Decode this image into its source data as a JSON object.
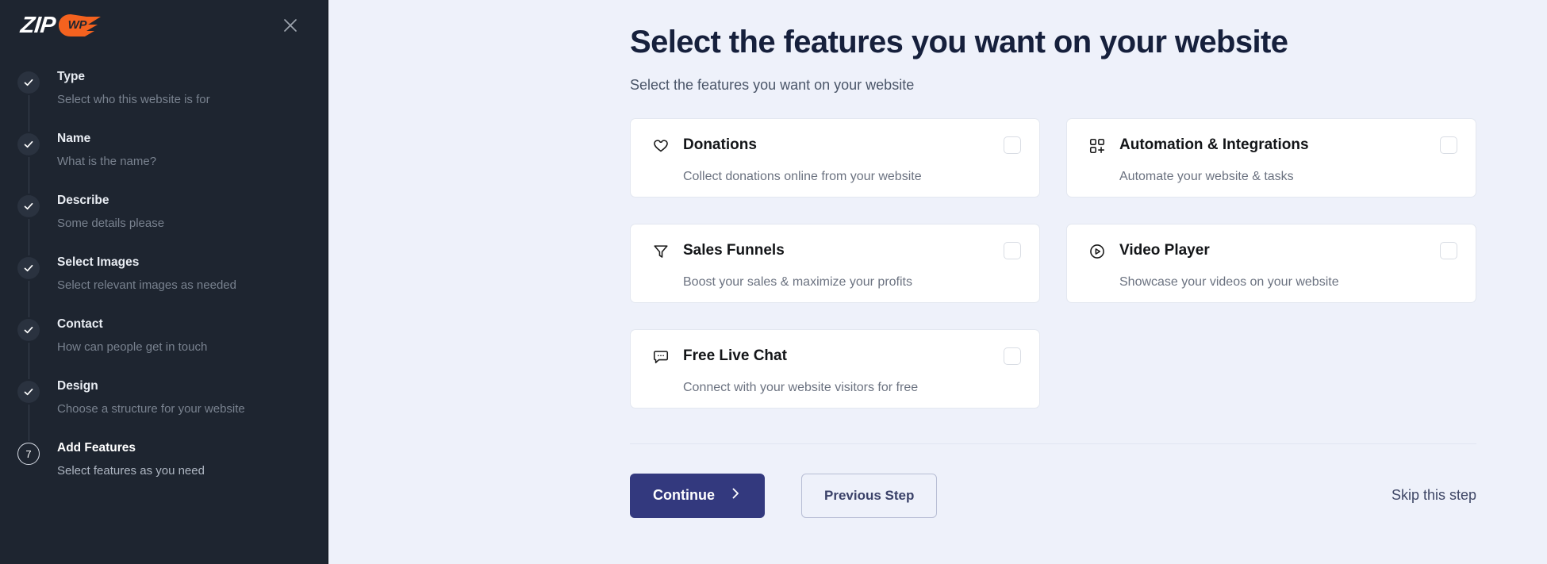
{
  "sidebar": {
    "logo": {
      "zip_text": "ZIP",
      "wp_text": "WP",
      "badge_color": "#f4621f"
    },
    "close_icon_name": "close-icon",
    "steps": [
      {
        "marker": "✓",
        "state": "done",
        "title": "Type",
        "sub": "Select who this website is for"
      },
      {
        "marker": "✓",
        "state": "done",
        "title": "Name",
        "sub": "What is the name?"
      },
      {
        "marker": "✓",
        "state": "done",
        "title": "Describe",
        "sub": "Some details please"
      },
      {
        "marker": "✓",
        "state": "done",
        "title": "Select Images",
        "sub": "Select relevant images as needed"
      },
      {
        "marker": "✓",
        "state": "done",
        "title": "Contact",
        "sub": "How can people get in touch"
      },
      {
        "marker": "✓",
        "state": "done",
        "title": "Design",
        "sub": "Choose a structure for your website"
      },
      {
        "marker": "7",
        "state": "active",
        "title": "Add Features",
        "sub": "Select features as you need"
      }
    ]
  },
  "main": {
    "title": "Select the features you want on your website",
    "subtitle": "Select the features you want on your website",
    "features": [
      {
        "icon": "heart-icon",
        "title": "Donations",
        "desc": "Collect donations online from your website",
        "checked": false
      },
      {
        "icon": "grid-plus-icon",
        "title": "Automation & Integrations",
        "desc": "Automate your website & tasks",
        "checked": false
      },
      {
        "icon": "funnel-icon",
        "title": "Sales Funnels",
        "desc": "Boost your sales & maximize your profits",
        "checked": false
      },
      {
        "icon": "play-circle-icon",
        "title": "Video Player",
        "desc": "Showcase your videos on your website",
        "checked": false
      },
      {
        "icon": "chat-bubble-icon",
        "title": "Free Live Chat",
        "desc": "Connect with your website visitors for free",
        "checked": false
      }
    ],
    "actions": {
      "continue_label": "Continue",
      "previous_label": "Previous Step",
      "skip_label": "Skip this step",
      "continue_bg": "#33397e"
    }
  }
}
